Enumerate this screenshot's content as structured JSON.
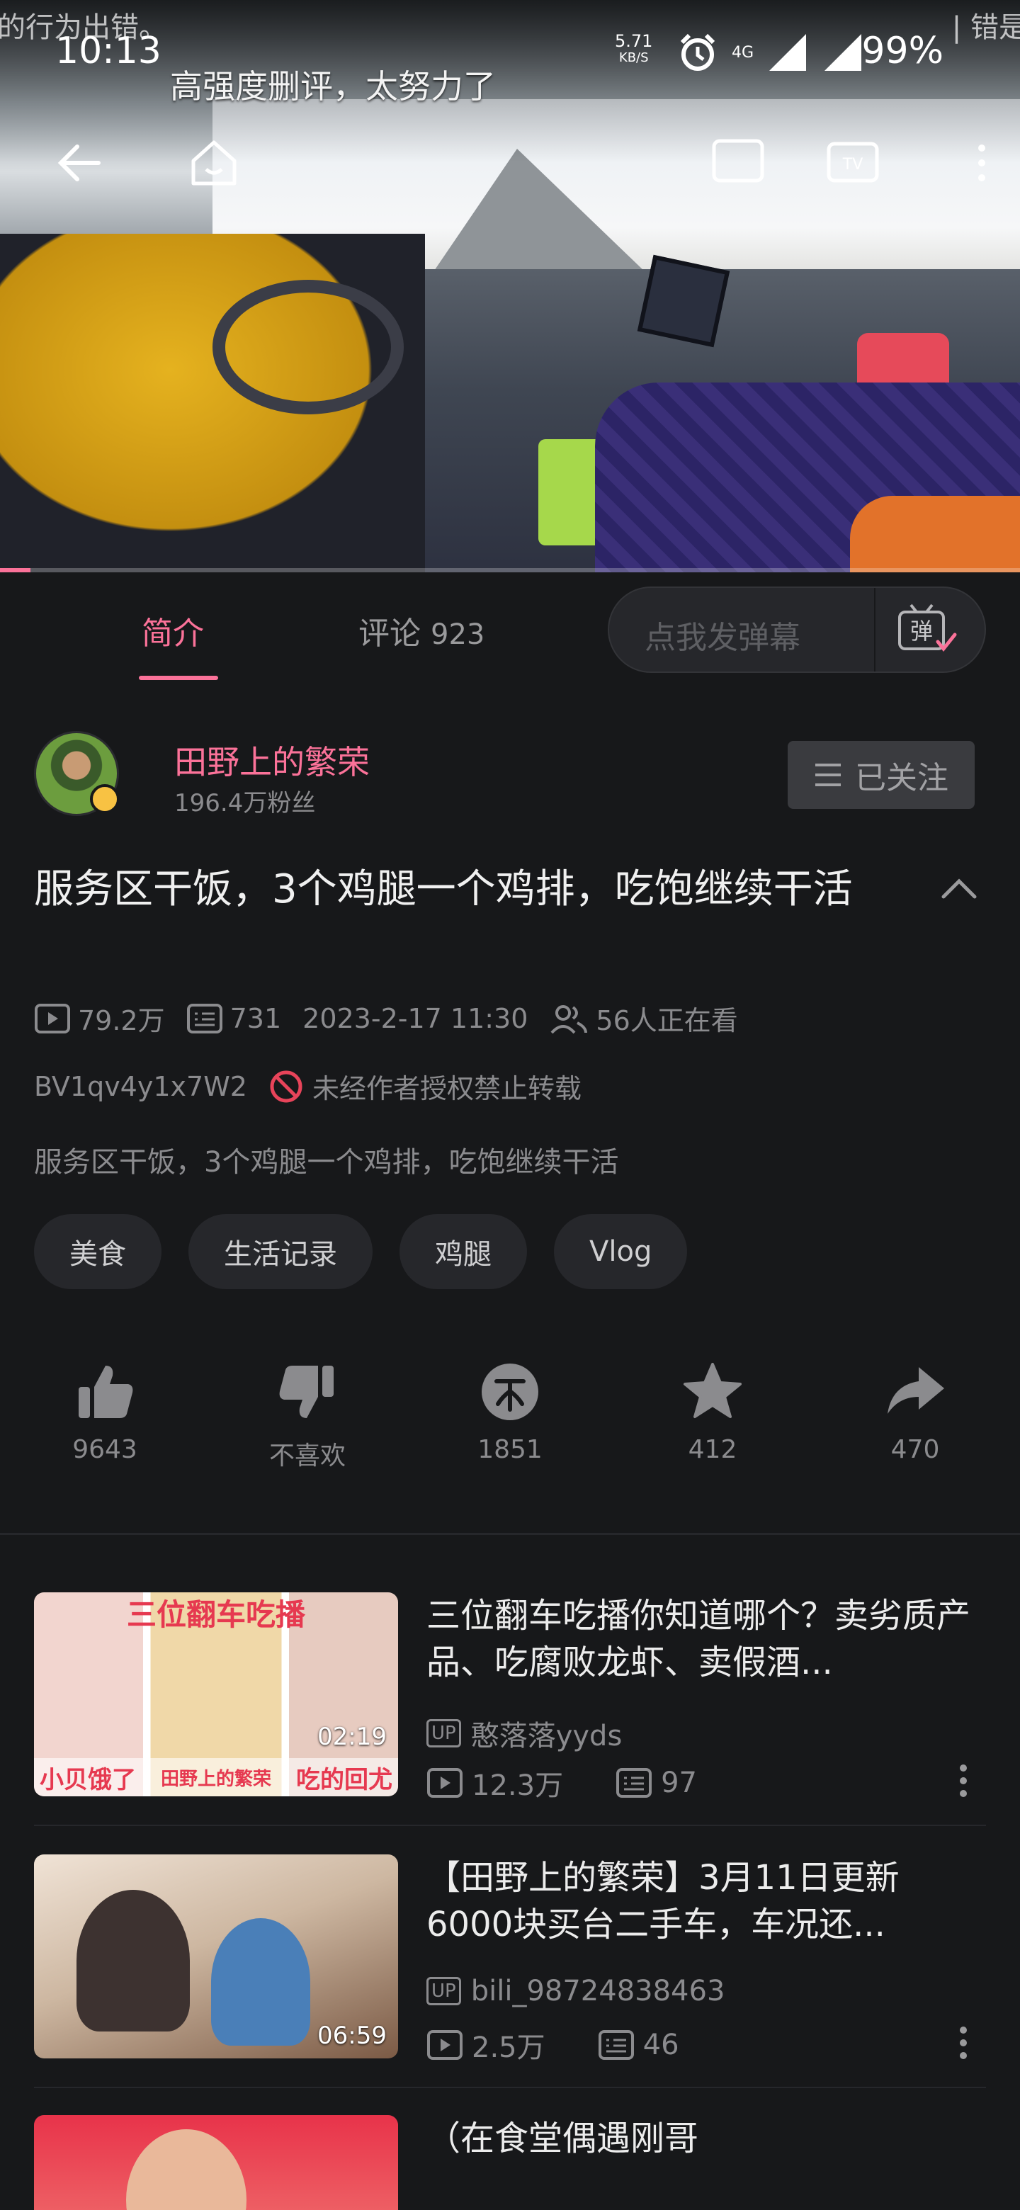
{
  "status_bar": {
    "time": "10:13",
    "net_speed_value": "5.71",
    "net_speed_unit": "KB/S",
    "network": "4G",
    "battery": "99%"
  },
  "video": {
    "danmu_text": "高强度删评，太努力了",
    "overlay_left": "的行为出错。",
    "overlay_right": "| 错是",
    "progress": 0.03,
    "buttons": {
      "back": "back-arrow-icon",
      "home": "home-icon",
      "mini": "mini-window-icon",
      "tv": "tv-cast-icon",
      "more": "more-icon"
    }
  },
  "tabs": {
    "intro": "简介",
    "comments_label": "评论",
    "comments_count": "923",
    "danmu_placeholder": "点我发弹幕",
    "danmu_icon_label": "弹"
  },
  "uploader": {
    "name": "田野上的繁荣",
    "fans": "196.4万粉丝",
    "follow_label": "已关注"
  },
  "video_info": {
    "title": "服务区干饭，3个鸡腿一个鸡排，吃饱继续干活",
    "views": "79.2万",
    "danmaku": "731",
    "date": "2023-2-17 11:30",
    "watching": "56人正在看",
    "bvid": "BV1qv4y1x7W2",
    "copyright": "未经作者授权禁止转载",
    "description": "服务区干饭，3个鸡腿一个鸡排，吃饱继续干活",
    "tags": [
      "美食",
      "生活记录",
      "鸡腿",
      "Vlog"
    ]
  },
  "actions": {
    "like": "9643",
    "dislike": "不喜欢",
    "coin": "1851",
    "favorite": "412",
    "share": "470"
  },
  "related": [
    {
      "title": "三位翻车吃播你知道哪个？卖劣质产品、吃腐败龙虾、卖假酒...",
      "up": "憨落落yyds",
      "views": "12.3万",
      "danmaku": "97",
      "duration": "02:19",
      "thumb_banner": "三位翻车吃播",
      "thumb_bottom_left": "小贝饿了",
      "thumb_bottom_mid": "田野上的繁荣",
      "thumb_bottom_right": "吃的回尤"
    },
    {
      "title": "【田野上的繁荣】3月11日更新6000块买台二手车，车况还...",
      "up": "bili_98724838463",
      "views": "2.5万",
      "danmaku": "46",
      "duration": "06:59"
    },
    {
      "title": "（在食堂偶遇刚哥"
    }
  ],
  "up_badge": "UP",
  "colors": {
    "accent": "#fb7299",
    "background": "#17181a",
    "muted": "#8b8b8e"
  }
}
